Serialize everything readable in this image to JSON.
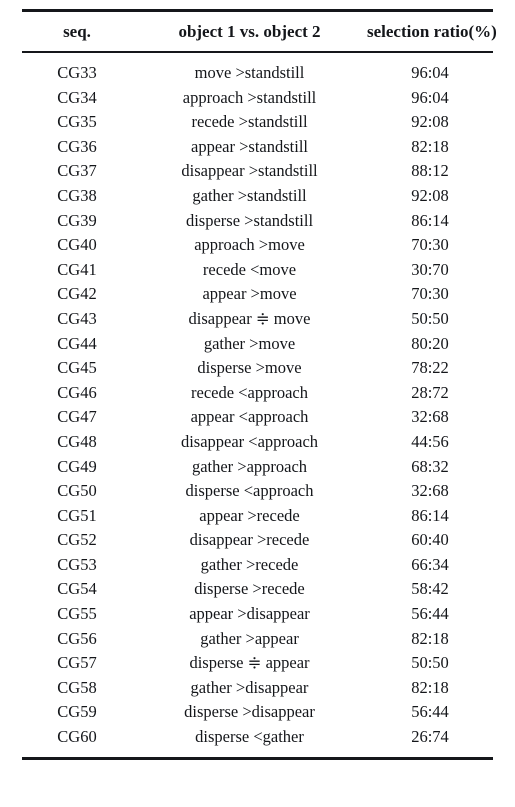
{
  "table": {
    "columns": [
      {
        "key": "seq",
        "label": "seq."
      },
      {
        "key": "pair",
        "label": "object 1 vs. object 2"
      },
      {
        "key": "ratio",
        "label": "selection ratio(%)"
      }
    ],
    "rows": [
      {
        "seq": "CG33",
        "pair": "move >standstill",
        "ratio": "96:04"
      },
      {
        "seq": "CG34",
        "pair": "approach >standstill",
        "ratio": "96:04"
      },
      {
        "seq": "CG35",
        "pair": "recede >standstill",
        "ratio": "92:08"
      },
      {
        "seq": "CG36",
        "pair": "appear >standstill",
        "ratio": "82:18"
      },
      {
        "seq": "CG37",
        "pair": "disappear >standstill",
        "ratio": "88:12"
      },
      {
        "seq": "CG38",
        "pair": "gather >standstill",
        "ratio": "92:08"
      },
      {
        "seq": "CG39",
        "pair": "disperse >standstill",
        "ratio": "86:14"
      },
      {
        "seq": "CG40",
        "pair": "approach >move",
        "ratio": "70:30"
      },
      {
        "seq": "CG41",
        "pair": "recede <move",
        "ratio": "30:70"
      },
      {
        "seq": "CG42",
        "pair": "appear >move",
        "ratio": "70:30"
      },
      {
        "seq": "CG43",
        "pair": "disappear ≑ move",
        "ratio": "50:50"
      },
      {
        "seq": "CG44",
        "pair": "gather >move",
        "ratio": "80:20"
      },
      {
        "seq": "CG45",
        "pair": "disperse >move",
        "ratio": "78:22"
      },
      {
        "seq": "CG46",
        "pair": "recede <approach",
        "ratio": "28:72"
      },
      {
        "seq": "CG47",
        "pair": "appear <approach",
        "ratio": "32:68"
      },
      {
        "seq": "CG48",
        "pair": "disappear <approach",
        "ratio": "44:56"
      },
      {
        "seq": "CG49",
        "pair": "gather >approach",
        "ratio": "68:32"
      },
      {
        "seq": "CG50",
        "pair": "disperse <approach",
        "ratio": "32:68"
      },
      {
        "seq": "CG51",
        "pair": "appear >recede",
        "ratio": "86:14"
      },
      {
        "seq": "CG52",
        "pair": "disappear >recede",
        "ratio": "60:40"
      },
      {
        "seq": "CG53",
        "pair": "gather >recede",
        "ratio": "66:34"
      },
      {
        "seq": "CG54",
        "pair": "disperse >recede",
        "ratio": "58:42"
      },
      {
        "seq": "CG55",
        "pair": "appear >disappear",
        "ratio": "56:44"
      },
      {
        "seq": "CG56",
        "pair": "gather >appear",
        "ratio": "82:18"
      },
      {
        "seq": "CG57",
        "pair": "disperse ≑ appear",
        "ratio": "50:50"
      },
      {
        "seq": "CG58",
        "pair": "gather >disappear",
        "ratio": "82:18"
      },
      {
        "seq": "CG59",
        "pair": "disperse >disappear",
        "ratio": "56:44"
      },
      {
        "seq": "CG60",
        "pair": "disperse <gather",
        "ratio": "26:74"
      }
    ]
  }
}
